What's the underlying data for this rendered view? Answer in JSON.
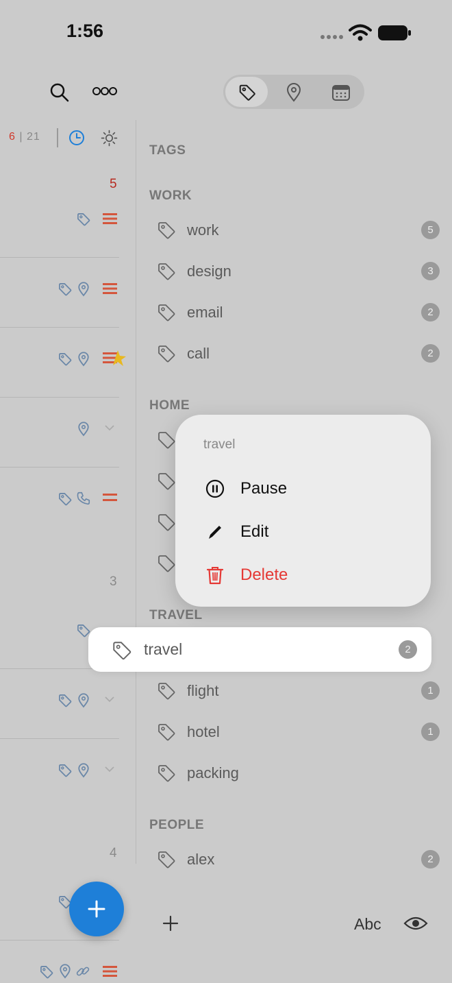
{
  "status": {
    "time": "1:56"
  },
  "left_panel": {
    "counter_overdue": "6",
    "counter_sep": "|",
    "counter_total": "21",
    "group_counts": [
      "5",
      "3",
      "4"
    ]
  },
  "segments": [
    "tag-icon",
    "location-icon",
    "calendar-icon"
  ],
  "tags_panel": {
    "heading": "TAGS",
    "sections": [
      {
        "title": "WORK",
        "items": [
          {
            "label": "work",
            "count": "5"
          },
          {
            "label": "design",
            "count": "3"
          },
          {
            "label": "email",
            "count": "2"
          },
          {
            "label": "call",
            "count": "2"
          }
        ]
      },
      {
        "title": "HOME"
      },
      {
        "title": "TRAVEL",
        "items": [
          {
            "label": "travel",
            "count": "2"
          },
          {
            "label": "flight",
            "count": "1"
          },
          {
            "label": "hotel",
            "count": "1"
          },
          {
            "label": "packing",
            "count": ""
          }
        ]
      },
      {
        "title": "PEOPLE",
        "items": [
          {
            "label": "alex",
            "count": "2"
          }
        ]
      }
    ]
  },
  "context_menu": {
    "title": "travel",
    "items": [
      {
        "label": "Pause",
        "icon": "pause-icon"
      },
      {
        "label": "Edit",
        "icon": "pencil-icon"
      },
      {
        "label": "Delete",
        "icon": "trash-icon",
        "color": "#e53935"
      }
    ]
  },
  "toolbar": {
    "text_toggle": "Abc"
  },
  "colors": {
    "accent": "#1e7fd8",
    "danger": "#e53935",
    "priority": "#d4563c",
    "star": "#e8b820"
  }
}
